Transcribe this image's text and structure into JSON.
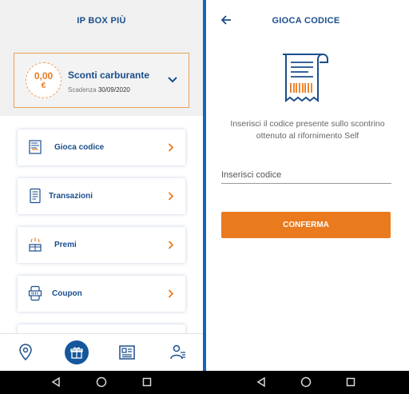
{
  "left": {
    "title": "IP BOX PIÙ",
    "discount": {
      "amount": "0,00",
      "currency": "€",
      "title": "Sconti carburante",
      "expiry_label": "Scadenza",
      "expiry_date": "30/09/2020"
    },
    "menu": [
      {
        "label": "Gioca codice",
        "icon": "receipt-icon"
      },
      {
        "label": "Transazioni",
        "icon": "transactions-icon"
      },
      {
        "label": "Premi",
        "icon": "prize-icon"
      },
      {
        "label": "Coupon",
        "icon": "coupon-icon"
      }
    ],
    "bottom_nav": [
      "location-pin-icon",
      "gift-icon",
      "news-icon",
      "profile-icon"
    ]
  },
  "right": {
    "title": "GIOCA CODICE",
    "instruction": "Inserisci il codice presente sullo scontrino ottenuto al rifornimento Self",
    "code_input": {
      "placeholder": "Inserisci codice",
      "value": ""
    },
    "confirm_label": "CONFERMA"
  },
  "colors": {
    "primary": "#1a4e8c",
    "accent": "#ea7a1e",
    "divider": "#1565c0"
  }
}
